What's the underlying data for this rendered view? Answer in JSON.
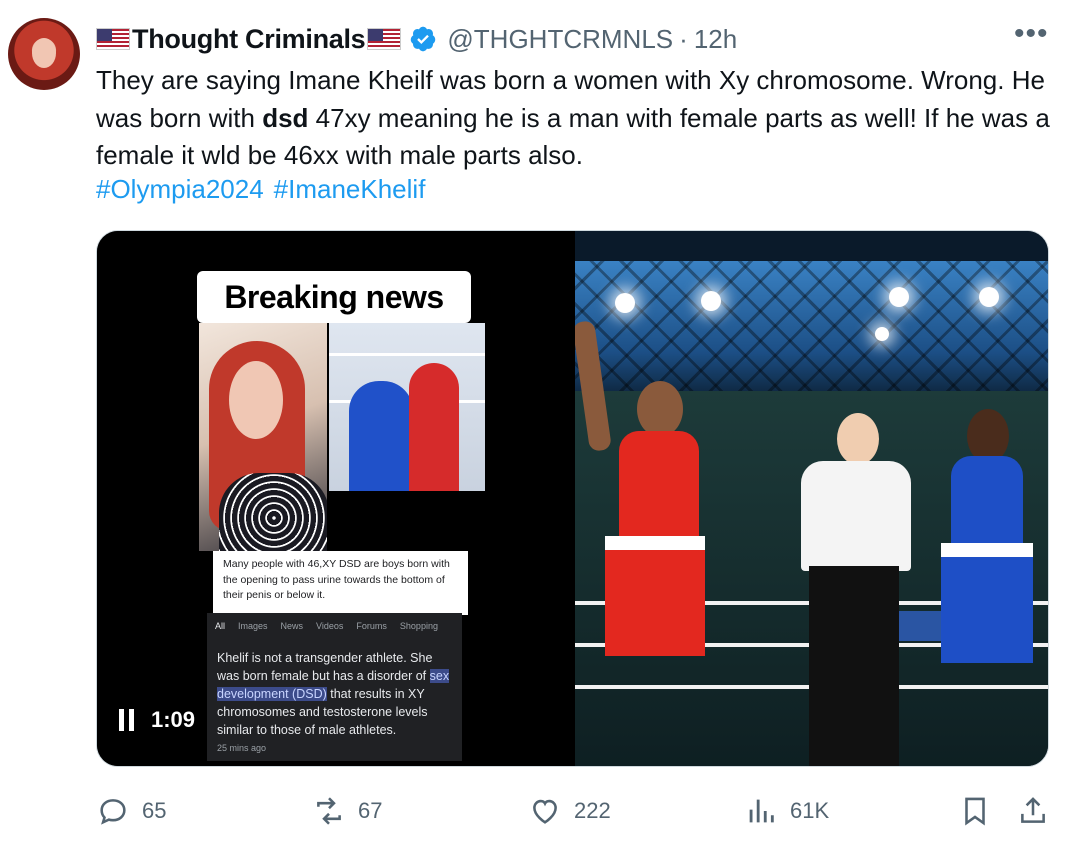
{
  "author": {
    "display_name": "Thought Criminals",
    "handle": "@THGHTCRMNLS",
    "separator": "·",
    "time": "12h",
    "verified": true,
    "avatar_icon": "profile-avatar",
    "flag_icon": "us-flag-icon"
  },
  "tweet": {
    "text_part1": "They are saying Imane Kheilf was born a women with Xy chromosome. Wrong. He was born with ",
    "text_bold": "dsd",
    "text_part2": " 47xy meaning he is a man with female parts as well! If he was a female it wld be 46xx with male parts also.",
    "hashtags": [
      "#Olympia2024",
      "#ImaneKhelif"
    ]
  },
  "media": {
    "video": {
      "banner": "Breaking news",
      "snippet_card": "Many people with 46,XY DSD are boys born with the opening to pass urine towards the bottom of their penis or below it.",
      "search_tabs": [
        "All",
        "Images",
        "News",
        "Videos",
        "Forums",
        "Shopping"
      ],
      "answer_pre": "Khelif is not a transgender athlete. She was born female but has a disorder of ",
      "answer_highlight": "sex development (DSD)",
      "answer_post": " that results in XY chromosomes and testosterone levels similar to those of male athletes.",
      "ago": "25 mins ago",
      "duration": "1:09",
      "state": "playing"
    }
  },
  "actions": {
    "replies": "65",
    "reposts": "67",
    "likes": "222",
    "views": "61K"
  },
  "colors": {
    "link": "#1d9bf0",
    "muted": "#536471",
    "text": "#0f1419",
    "verified": "#1d9bf0"
  }
}
